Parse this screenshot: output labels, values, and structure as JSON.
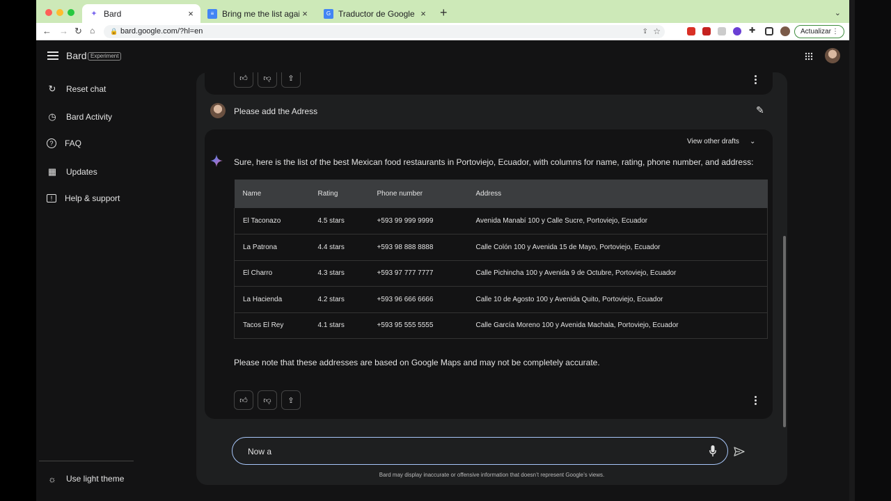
{
  "browser": {
    "tabs": [
      {
        "title": "Bard",
        "close": "×"
      },
      {
        "title": "Bring me the list again - Docum",
        "close": "×"
      },
      {
        "title": "Traductor de Google",
        "close": "×"
      }
    ],
    "new_tab": "+",
    "url": "bard.google.com/?hl=en",
    "update_button": "Actualizar"
  },
  "sidebar": {
    "brand": "Bard",
    "badge": "Experiment",
    "items": [
      {
        "label": "Reset chat",
        "icon": "reset-icon"
      },
      {
        "label": "Bard Activity",
        "icon": "history-icon"
      },
      {
        "label": "FAQ",
        "icon": "help-icon"
      },
      {
        "label": "Updates",
        "icon": "calendar-icon"
      },
      {
        "label": "Help & support",
        "icon": "feedback-icon"
      }
    ],
    "theme_toggle": "Use light theme"
  },
  "chat": {
    "user_message": "Please add the Adress",
    "view_drafts": "View other drafts",
    "bot_intro": "Sure, here is the list of the best Mexican food restaurants in Portoviejo, Ecuador, with columns for name, rating, phone number, and address:",
    "table": {
      "headers": [
        "Name",
        "Rating",
        "Phone number",
        "Address"
      ],
      "rows": [
        [
          "El Taconazo",
          "4.5 stars",
          "+593 99 999 9999",
          "Avenida Manabí 100 y Calle Sucre, Portoviejo, Ecuador"
        ],
        [
          "La Patrona",
          "4.4 stars",
          "+593 98 888 8888",
          "Calle Colón 100 y Avenida 15 de Mayo, Portoviejo, Ecuador"
        ],
        [
          "El Charro",
          "4.3 stars",
          "+593 97 777 7777",
          "Calle Pichincha 100 y Avenida 9 de Octubre, Portoviejo, Ecuador"
        ],
        [
          "La Hacienda",
          "4.2 stars",
          "+593 96 666 6666",
          "Calle 10 de Agosto 100 y Avenida Quito, Portoviejo, Ecuador"
        ],
        [
          "Tacos El Rey",
          "4.1 stars",
          "+593 95 555 5555",
          "Calle García Moreno 100 y Avenida Machala, Portoviejo, Ecuador"
        ]
      ]
    },
    "note": "Please note that these addresses are based on Google Maps and may not be completely accurate.",
    "prompt_value": "Now a",
    "disclaimer": "Bard may display inaccurate or offensive information that doesn’t represent Google’s views."
  },
  "colors": {
    "background": "#131314",
    "panel": "#1e1f20",
    "accent": "#a8c7fa",
    "tabstrip": "#cde9b8"
  }
}
